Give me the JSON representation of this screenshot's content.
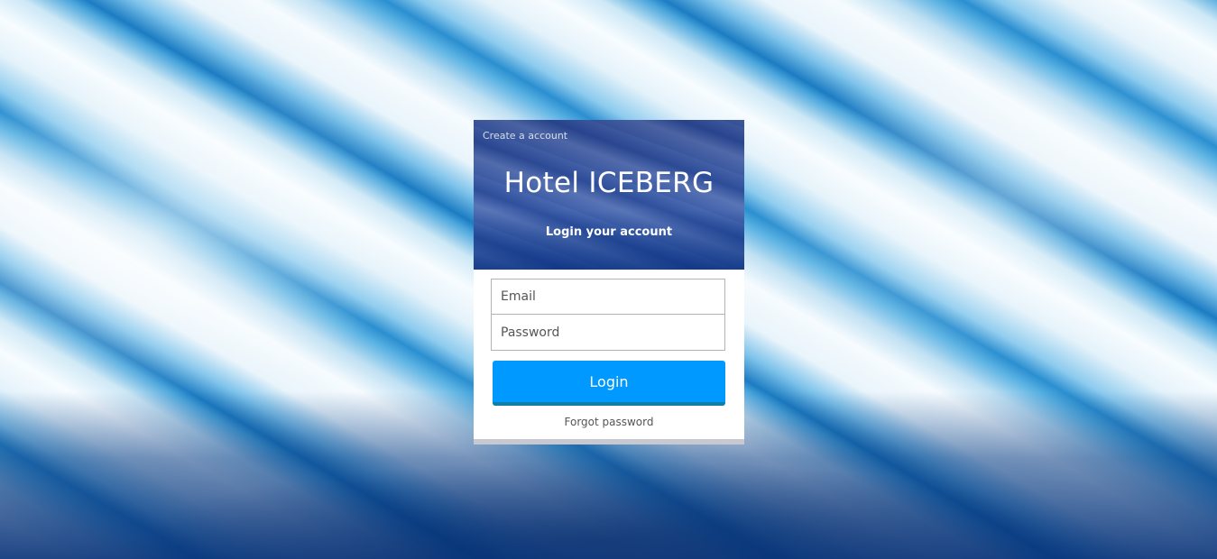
{
  "header": {
    "create_account_link": "Create a account",
    "title": "Hotel ICEBERG",
    "subtitle": "Login your account"
  },
  "form": {
    "email_placeholder": "Email",
    "password_placeholder": "Password",
    "login_label": "Login",
    "forgot_label": "Forgot password"
  },
  "colors": {
    "login_button": "#0099ff",
    "login_button_border": "#0f7fa8"
  }
}
